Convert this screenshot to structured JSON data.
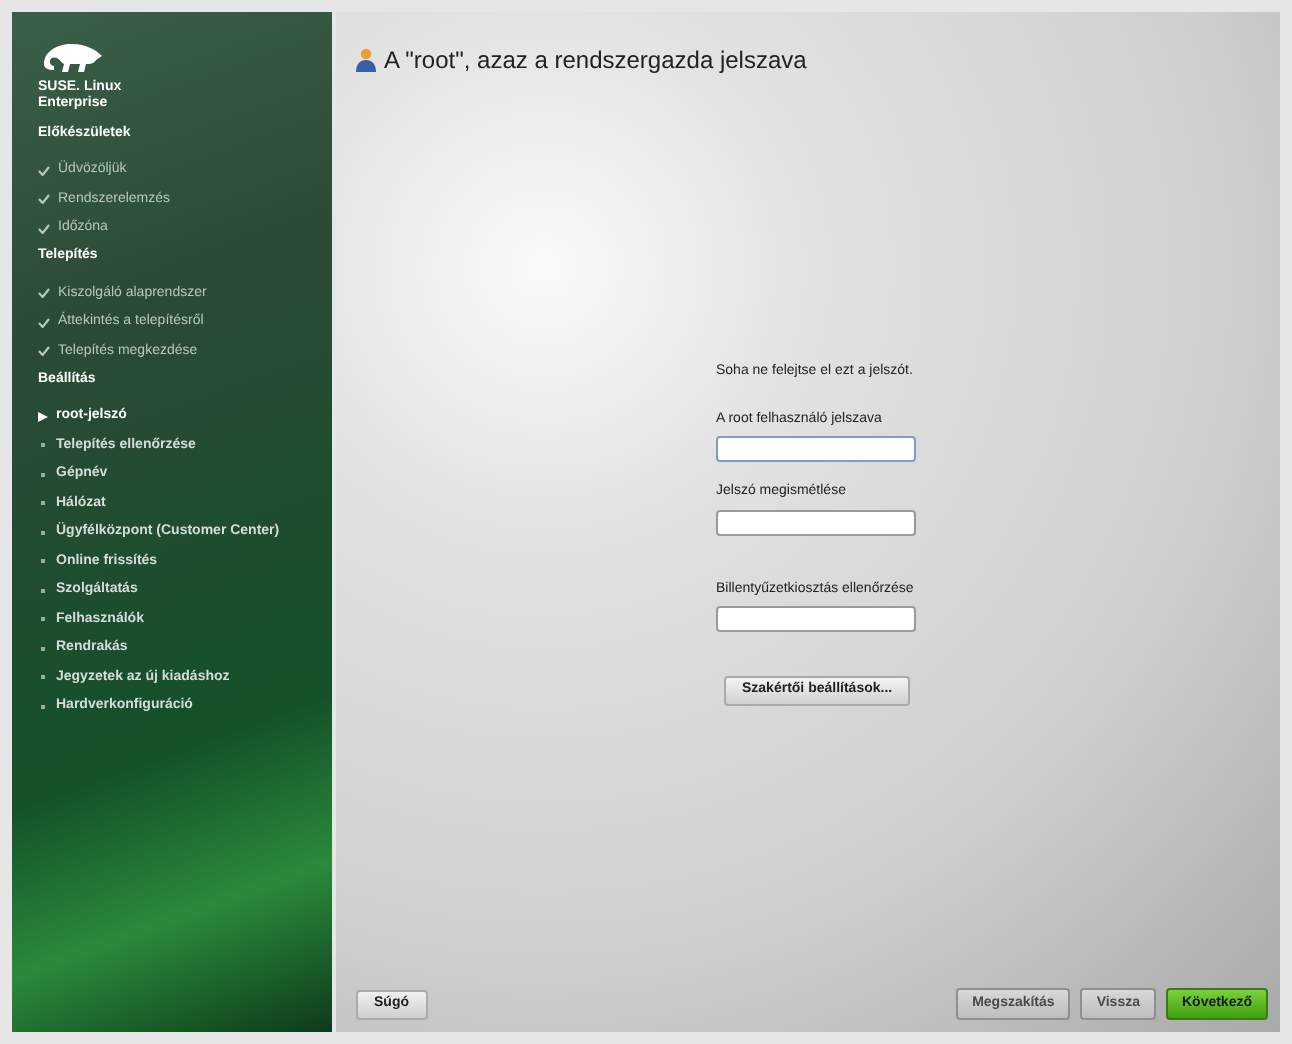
{
  "brand": {
    "line_1": "SUSE. Linux",
    "line_2": "Enterprise"
  },
  "sidebar": {
    "sections": [
      {
        "title": "Előkészületek",
        "steps": [
          {
            "label": "Üdvözöljük",
            "done": true,
            "selected": false
          },
          {
            "label": "Rendszerelemzés",
            "done": true,
            "selected": false
          },
          {
            "label": "Időzóna",
            "done": true,
            "selected": false
          }
        ]
      },
      {
        "title": "Telepítés",
        "steps": [
          {
            "label": "Kiszolgáló alaprendszer",
            "done": true,
            "selected": false
          },
          {
            "label": "Áttekintés a telepítésről",
            "done": true,
            "selected": false
          },
          {
            "label": "Telepítés megkezdése",
            "done": true,
            "selected": false
          }
        ]
      },
      {
        "title": "Beállítás",
        "steps": [
          {
            "label": "root-jelszó",
            "done": false,
            "selected": true
          },
          {
            "label": "Telepítés ellenőrzése",
            "done": false,
            "selected": false
          },
          {
            "label": "Gépnév",
            "done": false,
            "selected": false
          },
          {
            "label": "Hálózat",
            "done": false,
            "selected": false
          },
          {
            "label": "Ügyfélközpont (Customer Center)",
            "done": false,
            "selected": false
          },
          {
            "label": "Online frissítés",
            "done": false,
            "selected": false
          },
          {
            "label": "Szolgáltatás",
            "done": false,
            "selected": false
          },
          {
            "label": "Felhasználók",
            "done": false,
            "selected": false
          },
          {
            "label": "Rendrakás",
            "done": false,
            "selected": false
          },
          {
            "label": "Jegyzetek az új kiadáshoz",
            "done": false,
            "selected": false
          },
          {
            "label": "Hardverkonfiguráció",
            "done": false,
            "selected": false
          }
        ]
      }
    ]
  },
  "page_title": "A \"root\", azaz a rendszergazda jelszava",
  "form": {
    "note": "Soha ne felejtse el ezt a jelszót.",
    "fields": [
      {
        "label": "A root felhasználó jelszava",
        "focused": true
      },
      {
        "label": "Jelszó megismétlése",
        "focused": false
      },
      {
        "label": "Billentyűzetkiosztás ellenőrzése",
        "focused": false
      }
    ],
    "expert_button": "Szakértői beállítások..."
  },
  "buttons": {
    "help": "Súgó",
    "actions": [
      {
        "label": "Megszakítás",
        "kind": "plain",
        "disabled": true
      },
      {
        "label": "Vissza",
        "kind": "plain",
        "disabled": true
      },
      {
        "label": "Következő",
        "kind": "primary",
        "disabled": false
      }
    ]
  }
}
